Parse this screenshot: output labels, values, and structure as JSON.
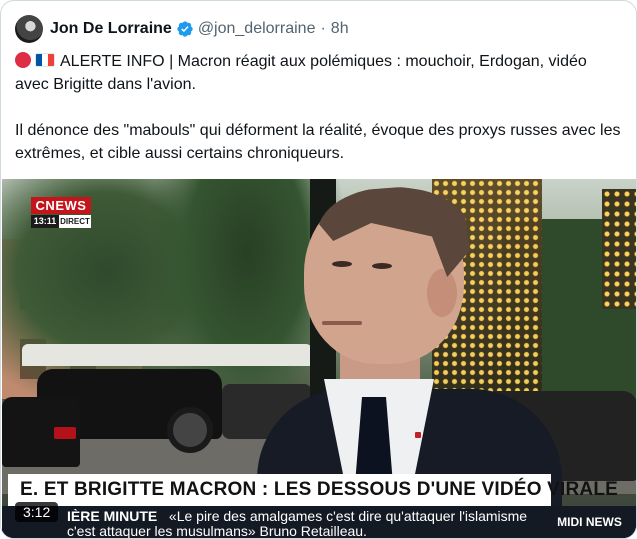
{
  "author": {
    "name": "Jon De Lorraine",
    "handle": "@jon_delorraine",
    "separator": "·",
    "time": "8h",
    "verified_icon": "verified-badge-icon"
  },
  "tweet": {
    "line1": "ALERTE INFO | Macron réagit aux polémiques : mouchoir, Erdogan, vidéo avec Brigitte dans l'avion.",
    "line2": "Il dénonce des \"mabouls\" qui déforment la réalité, évoque des proxys russes avec les extrêmes, et cible aussi certains chroniqueurs.",
    "emojis": [
      "red-circle-emoji",
      "france-flag-emoji"
    ]
  },
  "video": {
    "channel_logo": "CNEWS",
    "channel_time": "13:11",
    "channel_live": "DIRECT",
    "headline": "E. ET BRIGITTE MACRON : LES DESSOUS D'UNE VIDÉO VIRALE",
    "ticker_tag": "IÈRE MINUTE",
    "ticker_text": "«Le pire des amalgames c'est dire qu'attaquer l'islamisme c'est attaquer les musulmans» Bruno Retailleau.",
    "program": "MIDI NEWS",
    "duration": "3:12"
  },
  "colors": {
    "verified": "#1d9bf0",
    "cnews_red": "#c4151c",
    "ticker_bg": "#141a24",
    "text_secondary": "#536471"
  }
}
